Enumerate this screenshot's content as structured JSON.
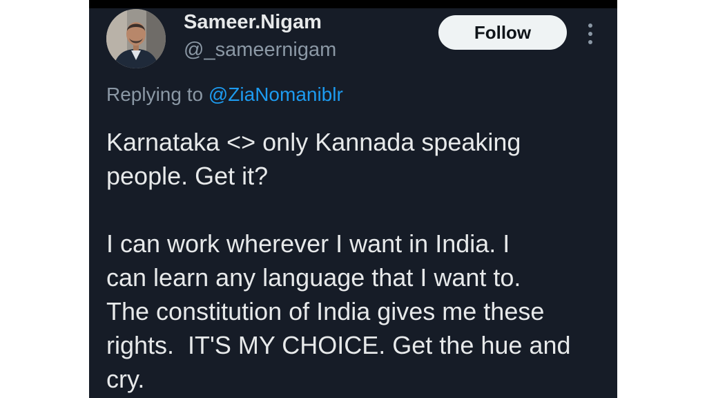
{
  "author": {
    "display_name": "Sameer.Nigam",
    "handle": "@_sameernigam"
  },
  "follow_button": {
    "label": "Follow"
  },
  "more_menu": {
    "icon": "more-vertical-icon"
  },
  "reply_context": {
    "prefix": "Replying to",
    "mention": "@ZiaNomaniblr"
  },
  "tweet": {
    "paragraph1": [
      "Karnataka <> only Kannada speaking",
      "people. Get it?"
    ],
    "paragraph2": [
      "I can work wherever I want in India. I",
      "can learn any language that I want to.",
      "The constitution of India gives me these",
      "rights.  IT'S MY CHOICE. Get the hue and",
      "cry."
    ]
  },
  "colors": {
    "background": "#161c27",
    "primary_text": "#e7e9ea",
    "secondary_text": "#8b98a5",
    "link": "#1d9bf0",
    "follow_button_bg": "#eff3f4"
  }
}
